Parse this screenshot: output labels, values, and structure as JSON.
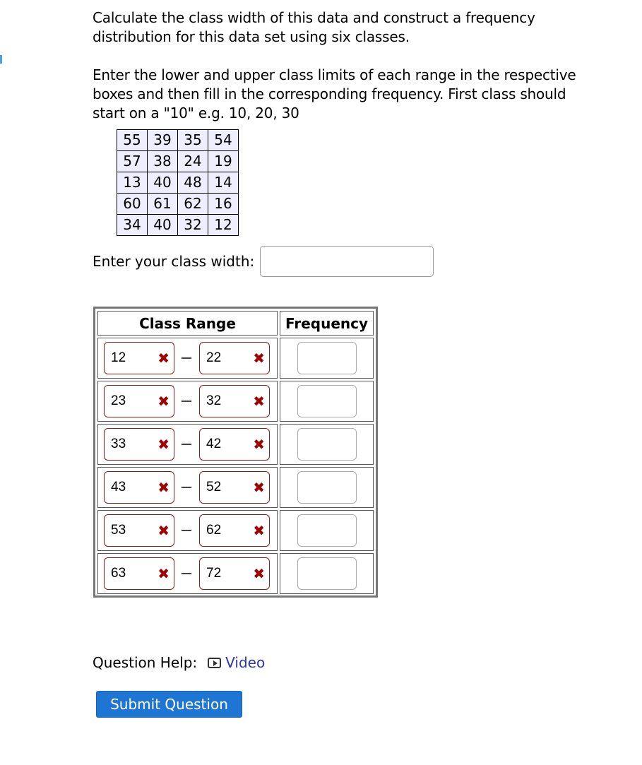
{
  "question": {
    "paragraph1": "Calculate the class width of this data and construct a frequency distribution for this data set using six classes.",
    "paragraph2": "Enter the lower and upper class limits of each range in the respective boxes and then fill in the corresponding frequency. First class should start on a \"10\" e.g. 10, 20, 30"
  },
  "data_set": [
    [
      "55",
      "39",
      "35",
      "54"
    ],
    [
      "57",
      "38",
      "24",
      "19"
    ],
    [
      "13",
      "40",
      "48",
      "14"
    ],
    [
      "60",
      "61",
      "62",
      "16"
    ],
    [
      "34",
      "40",
      "32",
      "12"
    ]
  ],
  "class_width": {
    "label": "Enter your class width:",
    "value": ""
  },
  "frequency_table": {
    "headers": {
      "range": "Class Range",
      "frequency": "Frequency"
    },
    "separator": "—",
    "incorrect_mark": "✖",
    "rows": [
      {
        "lower": "12",
        "upper": "22",
        "frequency": ""
      },
      {
        "lower": "23",
        "upper": "32",
        "frequency": ""
      },
      {
        "lower": "33",
        "upper": "42",
        "frequency": ""
      },
      {
        "lower": "43",
        "upper": "52",
        "frequency": ""
      },
      {
        "lower": "53",
        "upper": "62",
        "frequency": ""
      },
      {
        "lower": "63",
        "upper": "72",
        "frequency": ""
      }
    ]
  },
  "help": {
    "label": "Question Help:",
    "video_icon": "video-play-icon",
    "video_label": "Video"
  },
  "submit_label": "Submit Question",
  "colors": {
    "incorrect": "#a00000",
    "link": "#2b35a8",
    "button": "#1f75d3",
    "data_table_bg": "#eeeeff"
  }
}
